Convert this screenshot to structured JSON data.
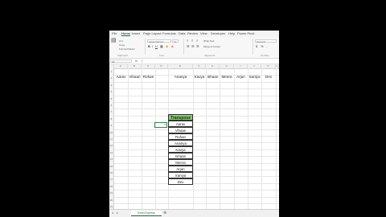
{
  "app": {
    "menu": [
      "File",
      "Home",
      "Insert",
      "Page Layout",
      "Formulas",
      "Data",
      "Review",
      "View",
      "Developer",
      "Help",
      "Power Pivot"
    ],
    "active_menu": "Home"
  },
  "ribbon": {
    "clipboard": {
      "cut": "Cut",
      "copy": "Copy",
      "format_painter": "Format Painter",
      "group_label": "Clipboard"
    },
    "font": {
      "name": "Aptos Narrow",
      "size": "11",
      "group_label": "Font"
    },
    "alignment": {
      "wrap_text": "Wrap Text",
      "merge_center": "Merge & Center",
      "group_label": "Alignment"
    },
    "number": {
      "format": "General",
      "group_label": "Number"
    }
  },
  "formula_bar": {
    "name_box": "A1",
    "fx": "fx"
  },
  "columns": [
    "A",
    "B",
    "C",
    "D",
    "E",
    "F",
    "G",
    "H",
    "I",
    "J",
    "K",
    "L"
  ],
  "row_numbers": [
    "1",
    "2",
    "3",
    "4",
    "5",
    "6",
    "7",
    "8",
    "9",
    "10",
    "11",
    "12",
    "13",
    "14",
    "15",
    "16",
    "17",
    "18",
    "19",
    "20",
    "21"
  ],
  "header_names": [
    "Aarav",
    "Vihaan",
    "Rohan",
    "Ananya",
    "Kavya",
    "Ishaan",
    "Meera",
    "Arjun",
    "Saniya",
    "Dev"
  ],
  "transpose": {
    "title": "Transpose",
    "values": [
      "Aarav",
      "Vihaan",
      "Rohan",
      "Ananya",
      "Kavya",
      "Ishaan",
      "Meera",
      "Arjun",
      "Saniya",
      "Dev"
    ]
  },
  "selected_cell_value": "0",
  "sheet_tab": "Excel Express",
  "accent_color": "#1f6e43",
  "header_fill_color": "#7cd35f"
}
